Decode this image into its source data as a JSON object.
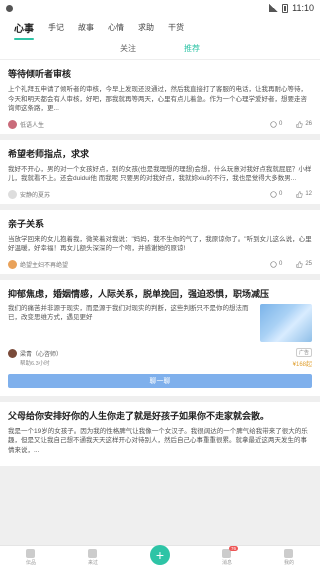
{
  "status": {
    "time": "11:10"
  },
  "topnav": {
    "items": [
      "心事",
      "手记",
      "故事",
      "心情",
      "求助",
      "干货"
    ]
  },
  "subtabs": [
    "关注",
    "推荐"
  ],
  "posts": [
    {
      "title": "等待倾听者审核",
      "body": "上个礼拜五申请了倾听者的审核，今早上发现还没通过，然后我直接打了客服的电话，让我再耐心等待，今天和明天都会有人审核，好吧，那我就再等两天，心里有点儿着急。作为一个心理学爱好者，想要走咨询师这条路，更...",
      "author": "低语人生",
      "comments": "0",
      "likes": "26"
    },
    {
      "title": "希望老师指点，求求",
      "body": "我好不开心，男的对一个女孩好点，别的女孩(也是我理想的理想)会想，什么玩意对我好点我就屁屁？小样儿，我就看不上。还会duidui他 而我呢 只要男的对我好点，我就妳xiu的不行，我也是觉得大多数男...",
      "author": "安静的夏苏",
      "comments": "0",
      "likes": "12"
    },
    {
      "title": "亲子关系",
      "body": "当放学回来的女儿抱着我，微笑着对我说：\"妈妈，我不生你的气了，我原谅你了。\"听到女儿这么说，心里好温暖，好幸福！再女儿额头深深的一个吻，并感谢她的原谅!",
      "author": "绝望主妇不再绝望",
      "comments": "0",
      "likes": "25"
    }
  ],
  "ad": {
    "title": "抑郁焦虑，婚姻情感，人际关系，脱单挽回，强迫恐惧，职场减压",
    "body": "我们的痛苦并非源于现实，而是源于我们对现实的判断，这些判断只不是你的想法而已，改变思维方式，遇见更好",
    "author": "梁青（心咨师）",
    "author_meta": "帮助6.3小时",
    "ad_label": "广告",
    "price": "¥168起",
    "button": "聊一聊"
  },
  "post4": {
    "title": "父母给你安排好你的人生你走了就是好孩子如果你不走家就会散。",
    "body": "我是一个19岁的女孩子。因为我的性格脾气让我像一个女汉子。我很阔达的一个脾气给我带来了很大的乐趣，但是又让我自己想不通我天天这样开心对待别人，然后自己心事重重很累。就拿最近这两天发生的事情来说，..."
  },
  "bottombar": {
    "tabs": [
      "伝品",
      "来过",
      "",
      "消息",
      "我的"
    ],
    "badge": "76"
  },
  "colors": {
    "accent": "#2ec4a6",
    "button": "#7fb0ec"
  }
}
